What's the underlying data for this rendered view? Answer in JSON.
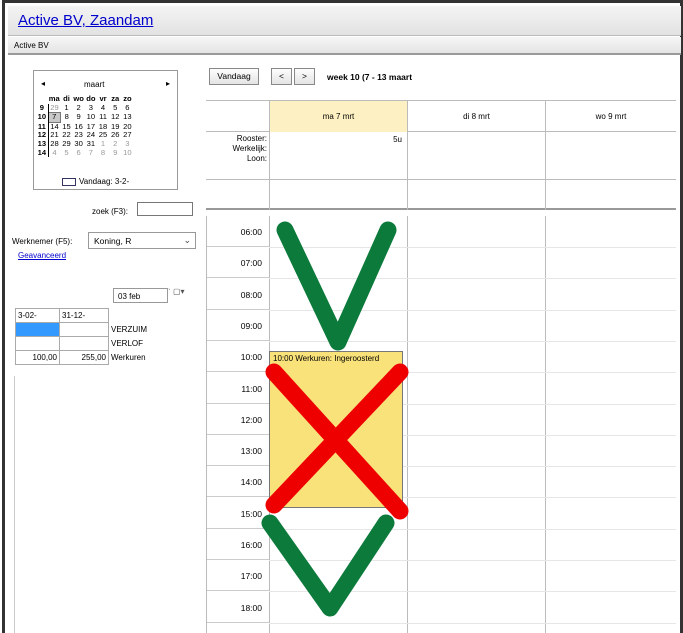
{
  "app": {
    "title": "Active BV, Zaandam",
    "subtitle": "Active BV"
  },
  "mini_calendar": {
    "prev": "◂",
    "next": "▸",
    "month": "maart",
    "weekday_headers": [
      "ma",
      "di",
      "wo",
      "do",
      "vr",
      "za",
      "zo"
    ],
    "weeks": [
      {
        "wk": "9",
        "days": [
          "29",
          "1",
          "2",
          "3",
          "4",
          "5",
          "6"
        ]
      },
      {
        "wk": "10",
        "days": [
          "7",
          "8",
          "9",
          "10",
          "11",
          "12",
          "13"
        ]
      },
      {
        "wk": "11",
        "days": [
          "14",
          "15",
          "16",
          "17",
          "18",
          "19",
          "20"
        ]
      },
      {
        "wk": "12",
        "days": [
          "21",
          "22",
          "23",
          "24",
          "25",
          "26",
          "27"
        ]
      },
      {
        "wk": "13",
        "days": [
          "28",
          "29",
          "30",
          "31",
          "1",
          "2",
          "3"
        ]
      },
      {
        "wk": "14",
        "days": [
          "4",
          "5",
          "6",
          "7",
          "8",
          "9",
          "10"
        ]
      }
    ],
    "today_label": "Vandaag: 3-2-"
  },
  "search": {
    "label": "zoek (F3):",
    "value": ""
  },
  "employee": {
    "label": "Werknemer (F5):",
    "selected": "Koning, R",
    "advanced_link": "Geavanceerd"
  },
  "date_picker": {
    "value": "03 feb"
  },
  "tally": {
    "headers": [
      "3-02-",
      "31-12-"
    ],
    "rows": [
      {
        "a": "",
        "b": "",
        "label": "VERZUIM"
      },
      {
        "a": "",
        "b": "",
        "label": "VERLOF"
      },
      {
        "a": "100,00",
        "b": "255,00",
        "label": "Werkuren"
      }
    ]
  },
  "toolbar": {
    "today_button": "Vandaag",
    "prev_button": "<",
    "next_button": ">",
    "week_label": "week 10 (7 - 13 maart"
  },
  "days": [
    {
      "label": "ma 7 mrt",
      "hours": "5u"
    },
    {
      "label": "di 8 mrt",
      "hours": ""
    },
    {
      "label": "wo 9 mrt",
      "hours": ""
    }
  ],
  "row_labels": {
    "rooster": "Rooster:",
    "werkelijk": "Werkelijk:",
    "loon": "Loon:"
  },
  "times": [
    "06:00",
    "07:00",
    "08:00",
    "09:00",
    "10:00",
    "11:00",
    "12:00",
    "13:00",
    "14:00",
    "15:00",
    "16:00",
    "17:00",
    "18:00"
  ],
  "event": {
    "text": "10:00 Werkuren: Ingeroosterd",
    "color": "#f9e27a"
  },
  "annotations": {
    "check_color": "#0b7a3b",
    "cross_color": "#ee0000"
  }
}
